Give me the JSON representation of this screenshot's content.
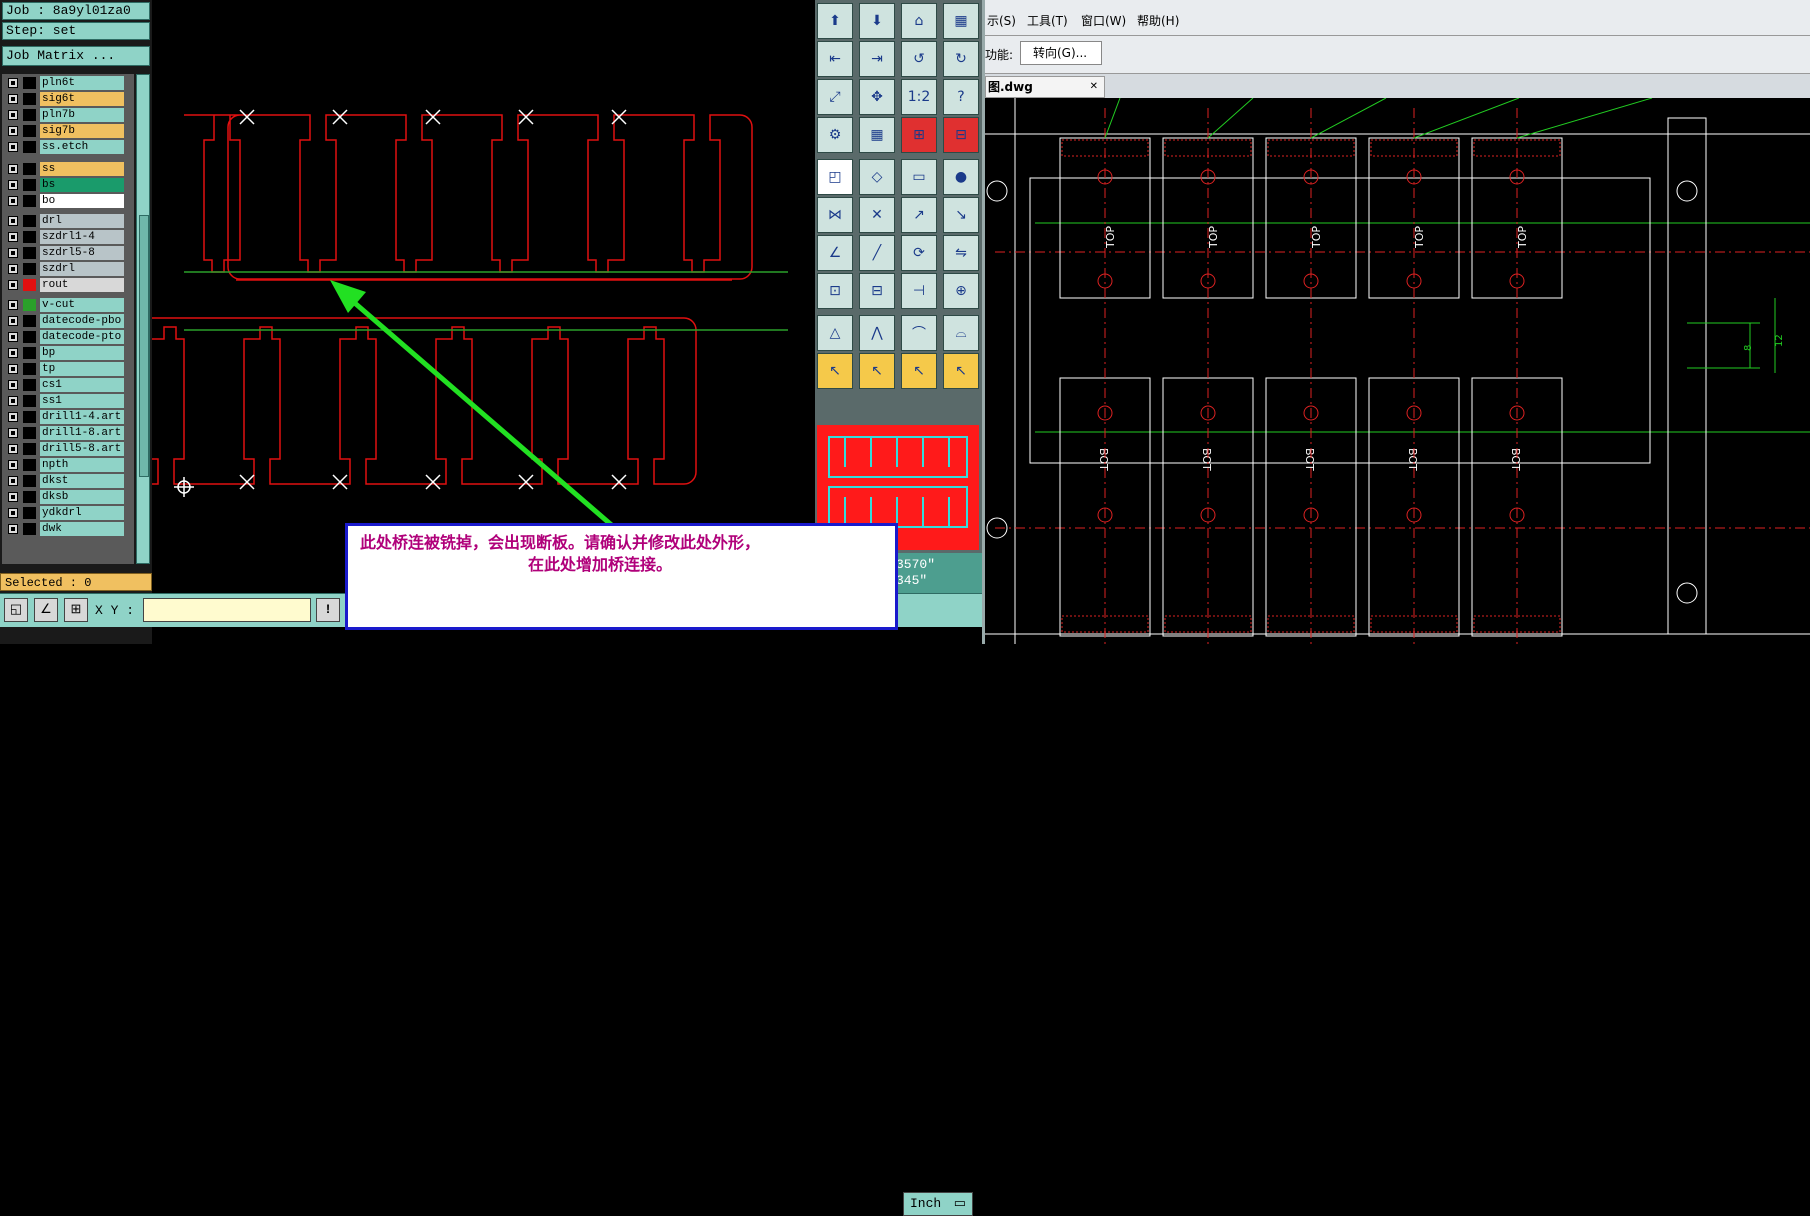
{
  "left_panel": {
    "job_line": "Job : 8a9yl01za0",
    "step_line": "Step: set",
    "job_matrix_button": "Job Matrix ...",
    "selected_line": "Selected : 0",
    "layers": [
      {
        "name": "pln6t",
        "color": "#8fd3c7",
        "swatch": "#000000"
      },
      {
        "name": "sig6t",
        "color": "#f0c060",
        "swatch": "#000000"
      },
      {
        "name": "pln7b",
        "color": "#8fd3c7",
        "swatch": "#000000"
      },
      {
        "name": "sig7b",
        "color": "#f0c060",
        "swatch": "#000000"
      },
      {
        "name": "ss.etch",
        "color": "#8fd3c7",
        "swatch": "#000000"
      },
      {
        "name": "ss",
        "color": "#f0c060",
        "swatch": "#000000"
      },
      {
        "name": "bs",
        "color": "#1a9b6b",
        "swatch": "#000000"
      },
      {
        "name": "bo",
        "color": "#ffffff",
        "swatch": "#000000"
      },
      {
        "name": "drl",
        "color": "#b8c4c8",
        "swatch": "#000000"
      },
      {
        "name": "szdrl1-4",
        "color": "#b8c4c8",
        "swatch": "#000000"
      },
      {
        "name": "szdrl5-8",
        "color": "#b8c4c8",
        "swatch": "#000000"
      },
      {
        "name": "szdrl",
        "color": "#b8c4c8",
        "swatch": "#000000"
      },
      {
        "name": "rout",
        "color": "#d8d8d8",
        "swatch": "#e01010"
      },
      {
        "name": "v-cut",
        "color": "#8fd3c7",
        "swatch": "#2aa02a"
      },
      {
        "name": "datecode-pbo",
        "color": "#8fd3c7",
        "swatch": "#000000"
      },
      {
        "name": "datecode-pto",
        "color": "#8fd3c7",
        "swatch": "#000000"
      },
      {
        "name": "bp",
        "color": "#8fd3c7",
        "swatch": "#000000"
      },
      {
        "name": "tp",
        "color": "#8fd3c7",
        "swatch": "#000000"
      },
      {
        "name": "cs1",
        "color": "#8fd3c7",
        "swatch": "#000000"
      },
      {
        "name": "ss1",
        "color": "#8fd3c7",
        "swatch": "#000000"
      },
      {
        "name": "drill1-4.art",
        "color": "#8fd3c7",
        "swatch": "#000000"
      },
      {
        "name": "drill1-8.art",
        "color": "#8fd3c7",
        "swatch": "#000000"
      },
      {
        "name": "drill5-8.art",
        "color": "#8fd3c7",
        "swatch": "#000000"
      },
      {
        "name": "npth",
        "color": "#8fd3c7",
        "swatch": "#000000"
      },
      {
        "name": "dkst",
        "color": "#8fd3c7",
        "swatch": "#000000"
      },
      {
        "name": "dksb",
        "color": "#8fd3c7",
        "swatch": "#000000"
      },
      {
        "name": "ydkdrl",
        "color": "#8fd3c7",
        "swatch": "#000000"
      },
      {
        "name": "dwk",
        "color": "#8fd3c7",
        "swatch": "#000000"
      }
    ]
  },
  "bottom_bar": {
    "xy_label": "X Y :",
    "xy_value": "",
    "info_button": "!"
  },
  "toolbox": {
    "coord_line1": "3570\"",
    "coord_line2": "345\"",
    "units": "Inch"
  },
  "annotation": {
    "line1": "此处桥连被铣掉，会出现断板。请确认并修改此处外形，",
    "line2": "在此处增加桥连接。"
  },
  "cad": {
    "menus": [
      "示(S)",
      "工具(T)",
      "窗口(W)",
      "帮助(H)"
    ],
    "command_label": "功能:",
    "turn_button": "转向(G)...",
    "file_tab": "图.dwg",
    "file_tab_close": "✕",
    "top_label": "TOP",
    "bot_label": "BOT",
    "dim_8": "8",
    "dim_12": "12"
  },
  "colors": {
    "panel_teal": "#8fd3c7",
    "rout_red": "#e01010",
    "vcut_green": "#2aa02a",
    "annotation_text": "#b0007a",
    "annotation_border": "#1a1acc",
    "arrow_green": "#22e022"
  }
}
